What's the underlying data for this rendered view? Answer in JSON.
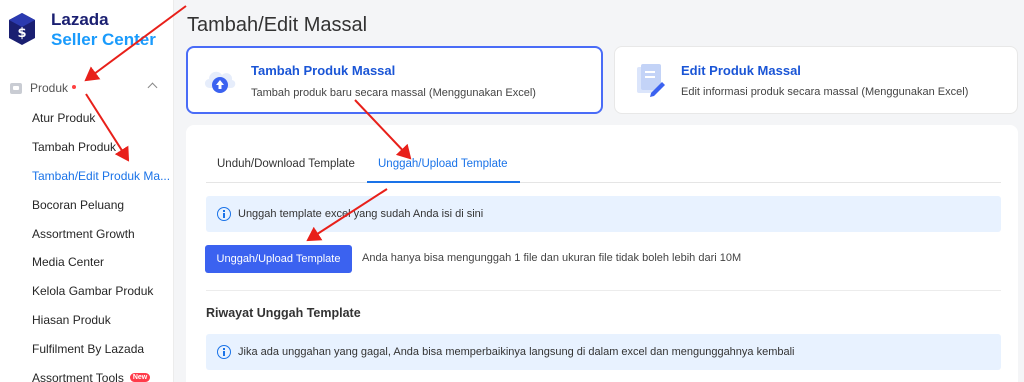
{
  "brand": {
    "line1": "Lazada",
    "line2": "Seller Center",
    "primary_color": "#1a1f71",
    "accent_color": "#1a9bfc"
  },
  "sidebar": {
    "group_label": "Produk",
    "items": [
      {
        "label": "Atur Produk"
      },
      {
        "label": "Tambah Produk"
      },
      {
        "label": "Tambah/Edit Produk Ma...",
        "active": true
      },
      {
        "label": "Bocoran Peluang"
      },
      {
        "label": "Assortment Growth"
      },
      {
        "label": "Media Center"
      },
      {
        "label": "Kelola Gambar Produk"
      },
      {
        "label": "Hiasan Produk"
      },
      {
        "label": "Fulfilment By Lazada"
      },
      {
        "label": "Assortment Tools",
        "badge": "New"
      }
    ]
  },
  "page": {
    "title": "Tambah/Edit Massal"
  },
  "cards": [
    {
      "title": "Tambah Produk Massal",
      "description": "Tambah produk baru secara massal (Menggunakan Excel)",
      "icon": "cloud-upload-icon",
      "selected": true
    },
    {
      "title": "Edit Produk Massal",
      "description": "Edit informasi produk secara massal (Menggunakan Excel)",
      "icon": "document-edit-icon",
      "selected": false
    }
  ],
  "tabs": [
    {
      "label": "Unduh/Download Template",
      "active": false
    },
    {
      "label": "Unggah/Upload Template",
      "active": true
    }
  ],
  "upload": {
    "info": "Unggah template excel yang sudah Anda isi di sini",
    "button_label": "Unggah/Upload Template",
    "note": "Anda hanya bisa mengunggah 1 file dan ukuran file tidak boleh lebih dari 10M"
  },
  "history": {
    "title": "Riwayat Unggah Template",
    "info": "Jika ada unggahan yang gagal, Anda bisa memperbaikinya langsung di dalam excel dan mengunggahnya kembali"
  },
  "colors": {
    "primary_blue": "#3b62f0",
    "link_blue": "#1a73e8",
    "annotation_red": "#e8201a",
    "info_bg": "#e8f2ff"
  }
}
